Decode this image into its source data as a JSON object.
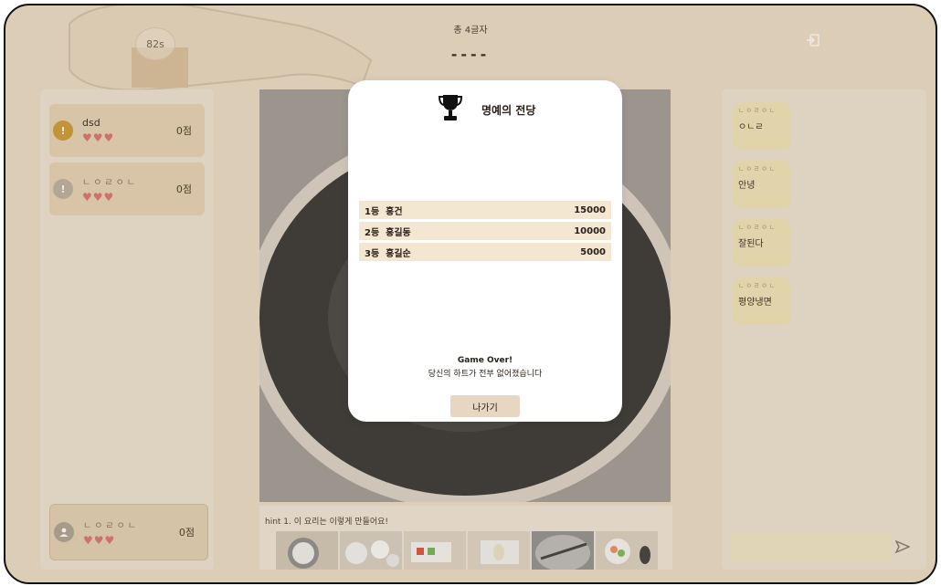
{
  "header": {
    "timer": "82s",
    "word_length_label": "총 4글자",
    "blanks": "----"
  },
  "players": [
    {
      "name": "dsd",
      "hearts": "♥♥♥",
      "score": "0점",
      "avatar_color": "#c9962e"
    },
    {
      "name": "ㄴㅇㄹㅇㄴ",
      "hearts": "♥♥♥",
      "score": "0점",
      "avatar_color": "#b8ad9e"
    }
  ],
  "self_player": {
    "name": "ㄴㅇㄹㅇㄴ",
    "hearts": "♥♥♥",
    "score": "0점",
    "avatar_color": "#a89e90"
  },
  "hint": {
    "text": "hint 1. 이 요리는 이렇게 만들어요!"
  },
  "chat": [
    {
      "user": "ㄴㅇㄹㅇㄴ",
      "message": "ㅇㄴㄹ"
    },
    {
      "user": "ㄴㅇㄹㅇㄴ",
      "message": "안녕"
    },
    {
      "user": "ㄴㅇㄹㅇㄴ",
      "message": "잘된다"
    },
    {
      "user": "ㄴㅇㄹㅇㄴ",
      "message": "평양냉면"
    }
  ],
  "chat_input": {
    "value": ""
  },
  "modal": {
    "title": "명예의 전당",
    "rankings": [
      {
        "rank": "1등",
        "name": "홍건",
        "score": "15000"
      },
      {
        "rank": "2등",
        "name": "홍길동",
        "score": "10000"
      },
      {
        "rank": "3등",
        "name": "홍길순",
        "score": "5000"
      }
    ],
    "game_over": "Game Over!",
    "game_over_sub": "당신의 하트가 전부 없어졌습니다",
    "exit_label": "나가기"
  },
  "colors": {
    "background": "#e9dcc6",
    "card": "#e4d2b4",
    "bubble": "#efe3b8",
    "heart": "#d86b6b",
    "rank_row": "#f3e7d2"
  },
  "icons": [
    "trophy-icon",
    "exit-icon",
    "send-icon",
    "exclamation-icon",
    "user-icon"
  ]
}
